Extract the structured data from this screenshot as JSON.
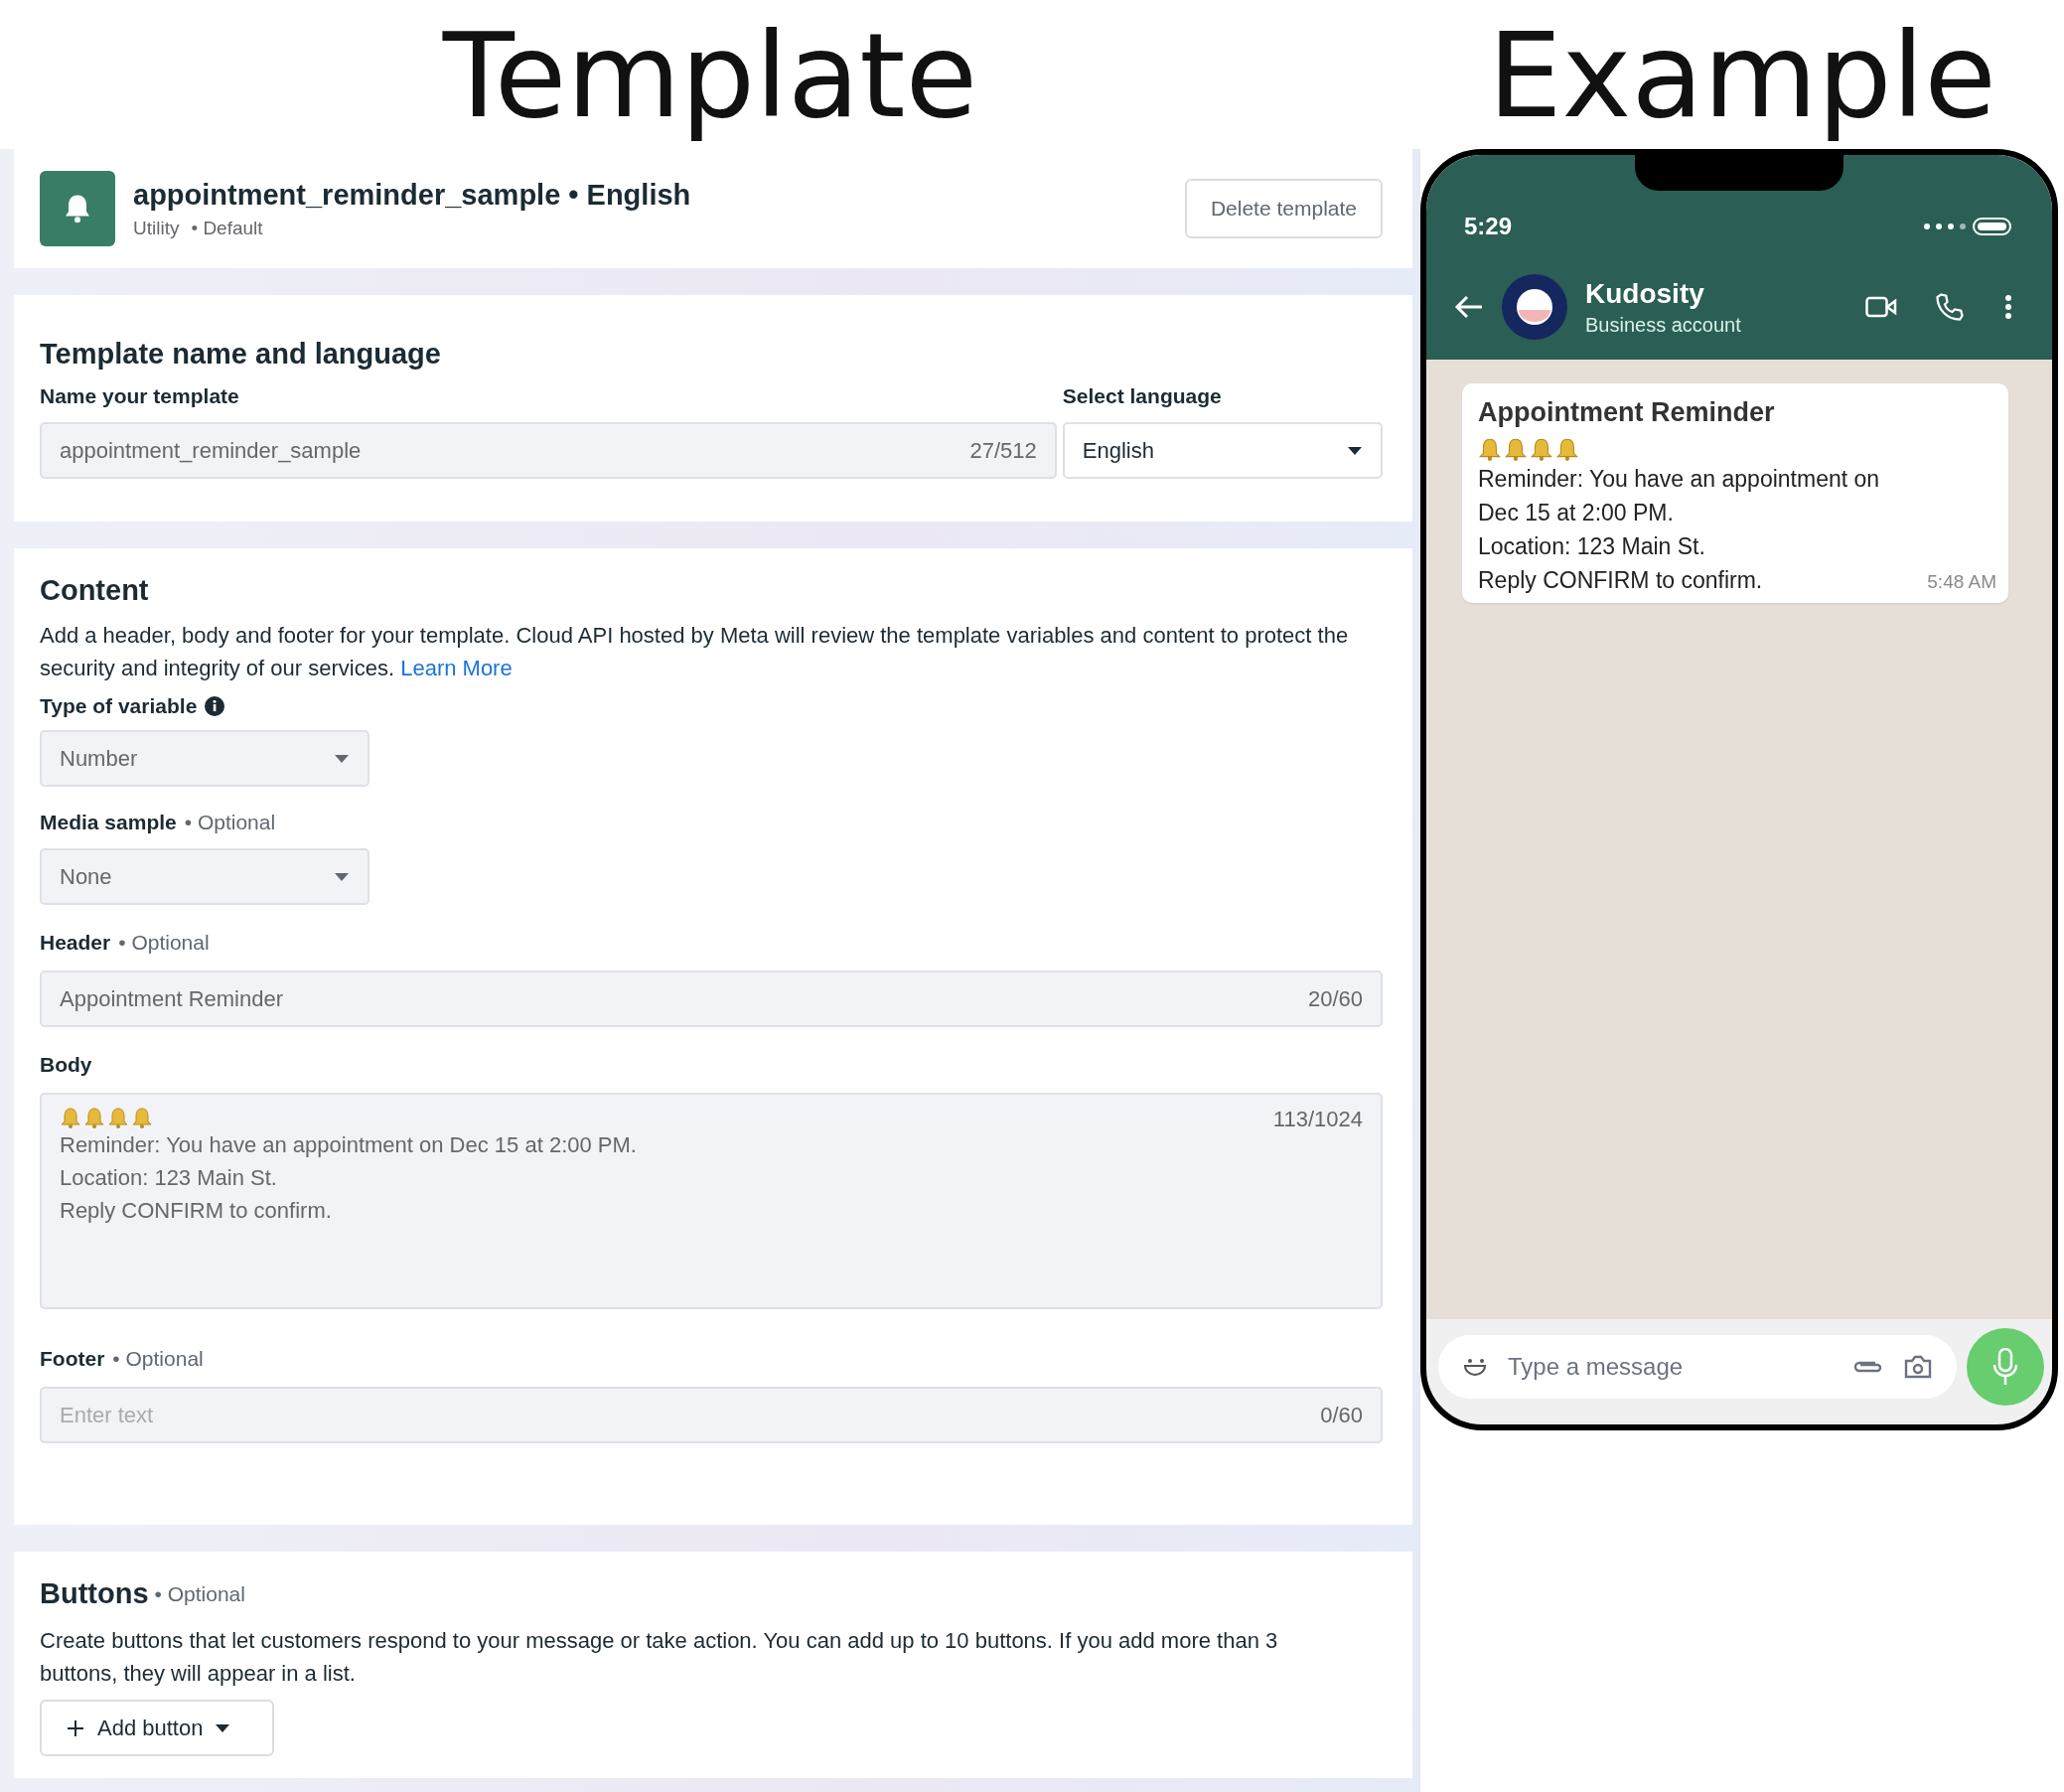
{
  "titles": [
    "Template",
    "Example"
  ],
  "template_header": {
    "name": "appointment_reminder_sample • English",
    "category": "Utility",
    "tag": "• Default",
    "delete_button": "Delete template"
  },
  "name_section": {
    "title": "Template name and language",
    "name_label": "Name your template",
    "name_value": "appointment_reminder_sample",
    "name_count": "27/512",
    "language_label": "Select language",
    "language_value": "English"
  },
  "content_section": {
    "title": "Content",
    "description": "Add a header, body and footer for your template. Cloud API hosted by Meta will review the template variables and content to protect the security and integrity of our services.",
    "link": "Learn More",
    "variable_label": "Type of variable",
    "variable_value": "Number",
    "media_label": "Media sample",
    "media_optional": "• Optional",
    "media_value": "None",
    "header_label": "Header",
    "header_optional": "• Optional",
    "header_value": "Appointment Reminder",
    "header_count": "20/60",
    "body_label": "Body",
    "body_lines": [
      "Reminder: You have an appointment on Dec 15 at 2:00 PM.",
      "Location: 123 Main St.",
      "Reply CONFIRM to confirm."
    ],
    "body_count": "113/1024",
    "footer_label": "Footer",
    "footer_optional": "• Optional",
    "footer_placeholder": "Enter text",
    "footer_count": "0/60"
  },
  "buttons_section": {
    "title": "Buttons",
    "optional": "• Optional",
    "description": "Create buttons that let customers respond to your message or take action. You can add up to 10 buttons. If you add more than 3 buttons, they will appear in a list.",
    "add_button": "Add button"
  },
  "phone": {
    "time": "5:29",
    "contact": "Kudosity",
    "subtitle": "Business account",
    "message_title": "Appointment Reminder",
    "message_lines": [
      "Reminder: You have an appointment on",
      "Dec 15 at 2:00 PM.",
      "Location: 123 Main St.",
      "Reply CONFIRM to confirm."
    ],
    "message_time": "5:48 AM",
    "input_placeholder": "Type a message"
  }
}
